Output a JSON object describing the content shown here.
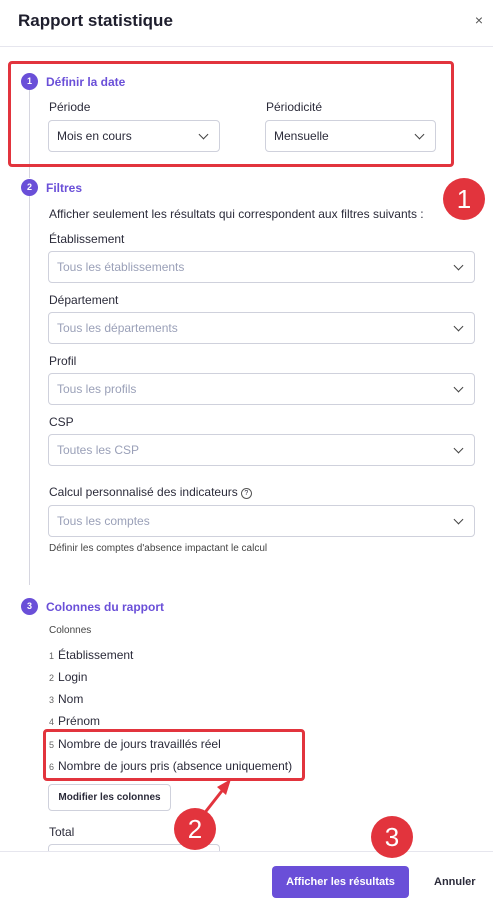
{
  "header": {
    "title": "Rapport statistique",
    "close_glyph": "×"
  },
  "step1": {
    "number": "1",
    "title": "Définir la date",
    "period_label": "Période",
    "period_value": "Mois en cours",
    "periodicity_label": "Périodicité",
    "periodicity_value": "Mensuelle"
  },
  "step2": {
    "number": "2",
    "title": "Filtres",
    "intro": "Afficher seulement les résultats qui correspondent aux filtres suivants :",
    "filters": [
      {
        "label": "Établissement",
        "placeholder": "Tous les établissements"
      },
      {
        "label": "Département",
        "placeholder": "Tous les départements"
      },
      {
        "label": "Profil",
        "placeholder": "Tous les profils"
      },
      {
        "label": "CSP",
        "placeholder": "Toutes les CSP"
      },
      {
        "label": "Calcul personnalisé des indicateurs",
        "placeholder": "Tous les comptes"
      }
    ],
    "help_glyph": "?",
    "calc_hint": "Définir les comptes d'absence impactant le calcul"
  },
  "step3": {
    "number": "3",
    "title": "Colonnes du rapport",
    "columns_label": "Colonnes",
    "columns": [
      {
        "n": "1",
        "label": "Établissement"
      },
      {
        "n": "2",
        "label": "Login"
      },
      {
        "n": "3",
        "label": "Nom"
      },
      {
        "n": "4",
        "label": "Prénom"
      },
      {
        "n": "5",
        "label": "Nombre de jours travaillés réel"
      },
      {
        "n": "6",
        "label": "Nombre de jours pris (absence uniquement)"
      }
    ],
    "modify_button": "Modifier les colonnes",
    "total_label": "Total"
  },
  "footer": {
    "primary_button": "Afficher les résultats",
    "cancel_button": "Annuler"
  },
  "annotations": {
    "badge1": "1",
    "badge2": "2",
    "badge3": "3",
    "color": "#e2343d"
  },
  "colors": {
    "accent": "#6a4fd8",
    "highlight": "#e2343d"
  }
}
